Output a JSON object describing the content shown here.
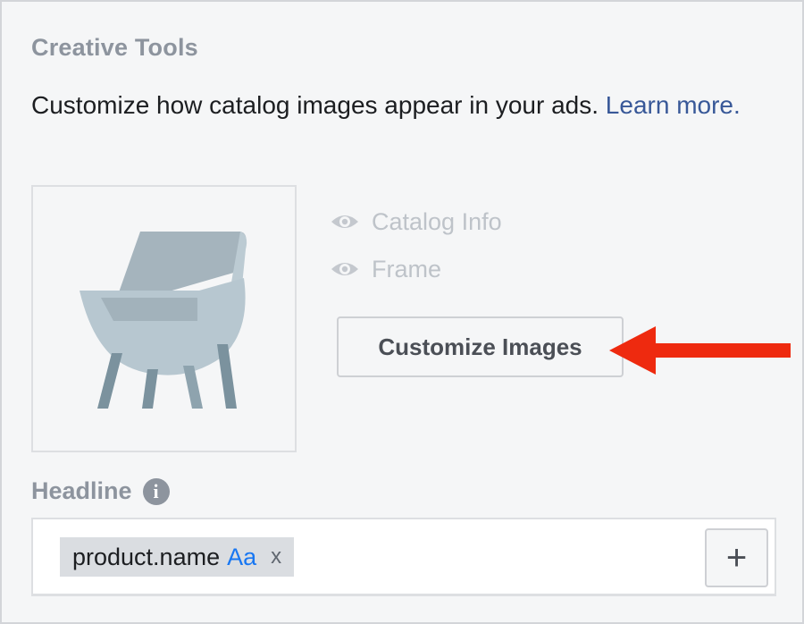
{
  "section": {
    "title": "Creative Tools",
    "description": "Customize how catalog images appear in your ads.",
    "learn_more": "Learn more."
  },
  "preview": {
    "image_icon": "chair-image"
  },
  "toggles": [
    {
      "label": "Catalog Info",
      "icon": "eye-icon"
    },
    {
      "label": "Frame",
      "icon": "eye-icon"
    }
  ],
  "customize_button": {
    "label": "Customize Images"
  },
  "annotation": {
    "color": "#ee2a0f"
  },
  "headline": {
    "label": "Headline",
    "info_glyph": "i",
    "token": {
      "text": "product.name",
      "aa": "Aa",
      "remove": "x"
    },
    "add_glyph": "+"
  },
  "colors": {
    "panel_bg": "#f5f6f7",
    "link": "#385898",
    "muted": "#8d949e",
    "token_bg": "#dadde1",
    "aa_blue": "#1877f2"
  }
}
